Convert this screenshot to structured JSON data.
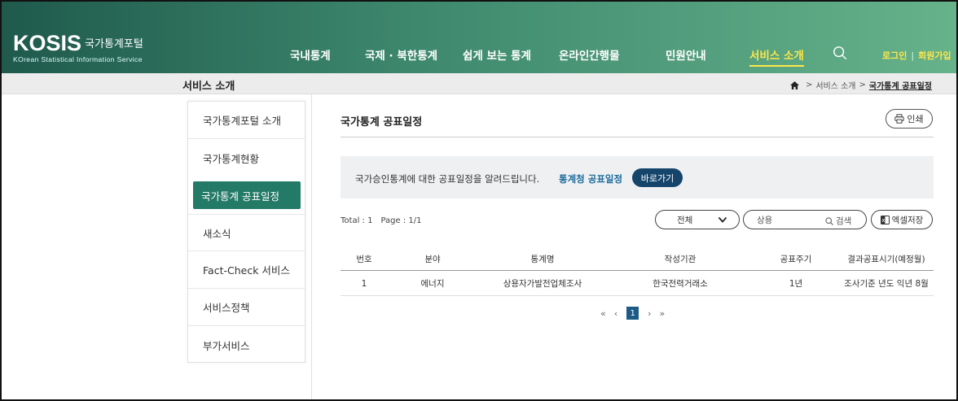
{
  "brand": {
    "logo_main": "KOSIS",
    "logo_kr": "국가통계포털",
    "logo_sub": "KOrean Statistical Information Service"
  },
  "nav": {
    "items": [
      "국내통계",
      "국제 · 북한통계",
      "쉽게 보는 통계",
      "온라인간행물",
      "민원안내",
      "서비스 소개"
    ],
    "active": "서비스 소개",
    "login": "로그인",
    "signup": "회원가입"
  },
  "subbar": {
    "title": "서비스 소개",
    "crumbs": [
      "서비스 소개",
      "국가통계 공표일정"
    ]
  },
  "side": {
    "items": [
      "국가통계포털 소개",
      "국가통계현황",
      "국가통계 공표일정",
      "새소식",
      "Fact-Check 서비스",
      "서비스정책",
      "부가서비스"
    ],
    "active_index": 2
  },
  "content": {
    "title": "국가통계 공표일정",
    "print_label": "인쇄",
    "notice_text": "국가승인통계에 대한 공표일정을 알려드립니다.",
    "notice_link": "통계청 공표일정",
    "notice_button": "바로가기",
    "total": "Total : 1",
    "page": "Page : 1/1",
    "select_value": "전체",
    "search_placeholder": "상용",
    "search_button": "검색",
    "excel_button": "엑셀저장"
  },
  "table": {
    "headers": [
      "번호",
      "분야",
      "통계명",
      "작성기관",
      "공표주기",
      "결과공표시기(예정월)"
    ],
    "rows": [
      [
        "1",
        "에너지",
        "상용자가발전업체조사",
        "한국전력거래소",
        "1년",
        "조사기준 년도 익년 8월"
      ]
    ]
  },
  "pager": {
    "first": "«",
    "prev": "‹",
    "current": "1",
    "next": "›",
    "last": "»"
  },
  "colors": {
    "header_start": "#1f5a4c",
    "header_end": "#66b28a",
    "nav_active": "#ffe74a",
    "side_active": "#237a66",
    "notice_button": "#16456b",
    "link": "#1d6c9c"
  }
}
